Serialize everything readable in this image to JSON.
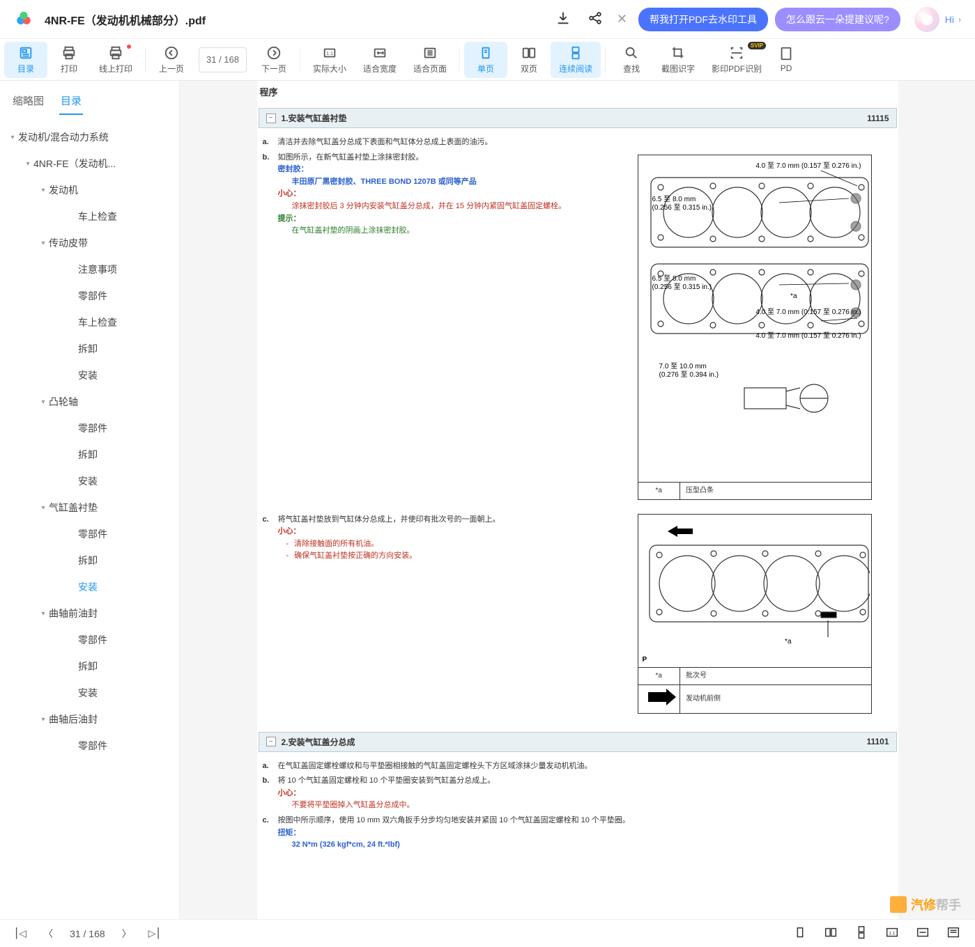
{
  "titlebar": {
    "docTitle": "4NR-FE（发动机机械部分）.pdf",
    "promoBlue": "帮我打开PDF去水印工具",
    "promoPurple": "怎么跟云一朵提建议呢?",
    "hi": "Hi"
  },
  "toolbar": {
    "catalog": "目录",
    "print": "打印",
    "onlinePrint": "线上打印",
    "prev": "上一页",
    "pageDisplay": "31  /  168",
    "next": "下一页",
    "actualSize": "实际大小",
    "fitWidth": "适合宽度",
    "fitPage": "适合页面",
    "singlePage": "单页",
    "doublePage": "双页",
    "continuousRead": "连续阅读",
    "find": "查找",
    "screenshotOcr": "截图识字",
    "scanPdfOcr": "影印PDF识别",
    "pdfMore": "PD",
    "vip": "SVIP"
  },
  "sidebar": {
    "thumbnails": "缩略图",
    "catalog": "目录",
    "items": [
      {
        "text": "发动机/混合动力系统",
        "indent": 0,
        "caret": true
      },
      {
        "text": "4NR-FE（发动机...",
        "indent": 1,
        "caret": true
      },
      {
        "text": "发动机",
        "indent": 2,
        "caret": true
      },
      {
        "text": "车上检查",
        "indent": 3
      },
      {
        "text": "传动皮带",
        "indent": 2,
        "caret": true
      },
      {
        "text": "注意事项",
        "indent": 3
      },
      {
        "text": "零部件",
        "indent": 3
      },
      {
        "text": "车上检查",
        "indent": 3
      },
      {
        "text": "拆卸",
        "indent": 3
      },
      {
        "text": "安装",
        "indent": 3
      },
      {
        "text": "凸轮轴",
        "indent": 2,
        "caret": true
      },
      {
        "text": "零部件",
        "indent": 3
      },
      {
        "text": "拆卸",
        "indent": 3
      },
      {
        "text": "安装",
        "indent": 3
      },
      {
        "text": "气缸盖衬垫",
        "indent": 2,
        "caret": true
      },
      {
        "text": "零部件",
        "indent": 3
      },
      {
        "text": "拆卸",
        "indent": 3
      },
      {
        "text": "安装",
        "indent": 3,
        "active": true
      },
      {
        "text": "曲轴前油封",
        "indent": 2,
        "caret": true
      },
      {
        "text": "零部件",
        "indent": 3
      },
      {
        "text": "拆卸",
        "indent": 3
      },
      {
        "text": "安装",
        "indent": 3
      },
      {
        "text": "曲轴后油封",
        "indent": 2,
        "caret": true
      },
      {
        "text": "零部件",
        "indent": 3
      }
    ]
  },
  "doc": {
    "pageTitle": "程序",
    "section1": {
      "title": "1.安装气缸盖衬垫",
      "code": "11115"
    },
    "stepA": {
      "letter": "a.",
      "text": "清洁并去除气缸盖分总成下表面和气缸体分总成上表面的油污。"
    },
    "stepB": {
      "letter": "b.",
      "text": "如图所示，在新气缸盖衬垫上涂抹密封胶。",
      "sealLabel": "密封胶：",
      "sealText": "丰田原厂黑密封胶、THREE BOND 1207B 或同等产品",
      "careLabel": "小心：",
      "careText": "涂抹密封胶后 3 分钟内安装气缸盖分总成，并在 15 分钟内紧固气缸盖固定螺栓。",
      "hintLabel": "提示：",
      "hintText": "在气缸盖衬垫的阴画上涂抹密封胶。"
    },
    "dims": {
      "d1": "4.0 至 7.0 mm (0.157 至 0.276 in.)",
      "d2a": "6.5 至 8.0 mm",
      "d2b": "(0.256 至 0.315 in.)",
      "d3a": "6.5 至 8.0 mm",
      "d3b": "(0.256 至 0.315 in.)",
      "d4": "4.0 至 7.0 mm (0.157 至 0.276 in.)",
      "d5": "4.0 至 7.0 mm (0.157 至 0.276 in.)",
      "d6a": "7.0 至 10.0 mm",
      "d6b": "(0.276 至 0.394 in.)",
      "starA": "*a"
    },
    "legend1": {
      "key": "*a",
      "value": "压型凸条"
    },
    "stepC": {
      "letter": "c.",
      "text": "将气缸盖衬垫放到气缸体分总成上，并使印有批次号的一面朝上。",
      "careLabel": "小心：",
      "care1": "清除接触面的所有机油。",
      "care2": "确保气缸盖衬垫按正确的方向安装。"
    },
    "legend2": {
      "key1": "*a",
      "value1": "批次号",
      "value2": "发动机前侧"
    },
    "diagram2": {
      "starA": "*a",
      "P": "P"
    },
    "section2": {
      "title": "2.安装气缸盖分总成",
      "code": "11101"
    },
    "stepA2": {
      "letter": "a.",
      "text": "在气缸盖固定螺栓螺纹和与平垫圈相接触的气缸盖固定螺栓头下方区域涂抹少量发动机机油。"
    },
    "stepB2": {
      "letter": "b.",
      "text": "将 10 个气缸盖固定螺栓和 10 个平垫圈安装到气缸盖分总成上。",
      "careLabel": "小心：",
      "careText": "不要将平垫圈掉入气缸盖分总成中。"
    },
    "stepC2": {
      "letter": "c.",
      "text": "按图中所示顺序，使用 10 mm 双六角扳手分步均匀地安装并紧固 10 个气缸盖固定螺栓和 10 个平垫圈。",
      "torqueLabel": "扭矩：",
      "torqueText": "32 N*m (326 kgf*cm, 24 ft.*lbf)"
    }
  },
  "bottombar": {
    "pageDisplay": "31  /  168"
  },
  "watermark": {
    "t1": "汽修",
    "t2": "帮手"
  }
}
